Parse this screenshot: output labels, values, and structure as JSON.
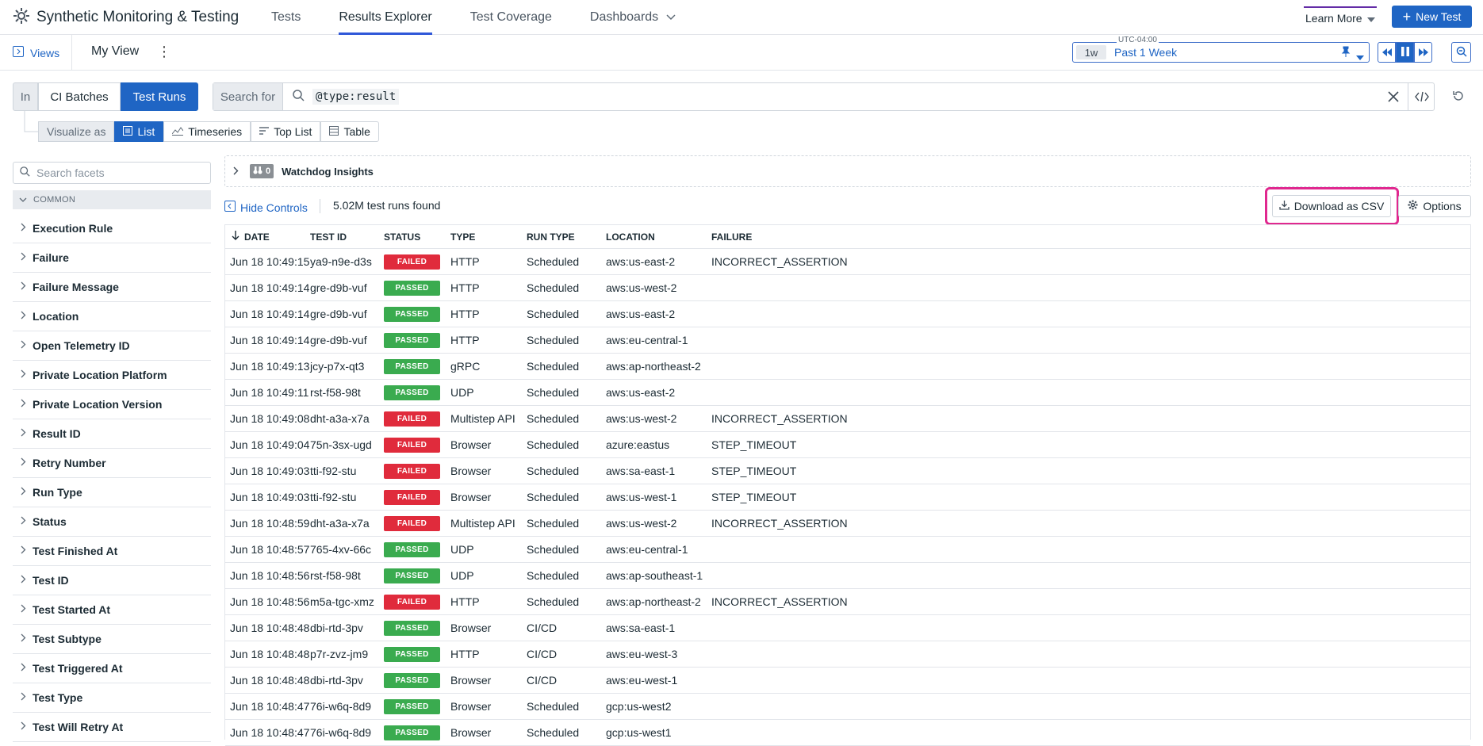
{
  "app": {
    "title": "Synthetic Monitoring & Testing"
  },
  "nav": {
    "tabs": [
      "Tests",
      "Results Explorer",
      "Test Coverage",
      "Dashboards"
    ],
    "active": "Results Explorer"
  },
  "header": {
    "learn_more": "Learn More",
    "new_test": "New Test"
  },
  "viewbar": {
    "views": "Views",
    "view_name": "My View"
  },
  "time": {
    "timezone": "UTC-04:00",
    "badge": "1w",
    "label": "Past 1 Week"
  },
  "scope": {
    "in_label": "In",
    "options": [
      "CI Batches",
      "Test Runs"
    ],
    "selected": "Test Runs"
  },
  "search": {
    "label": "Search for",
    "query": "@type:result"
  },
  "visualize": {
    "label": "Visualize as",
    "options": [
      "List",
      "Timeseries",
      "Top List",
      "Table"
    ],
    "selected": "List"
  },
  "facets": {
    "search_placeholder": "Search facets",
    "group": "COMMON",
    "items": [
      "Execution Rule",
      "Failure",
      "Failure Message",
      "Location",
      "Open Telemetry ID",
      "Private Location Platform",
      "Private Location Version",
      "Result ID",
      "Retry Number",
      "Run Type",
      "Status",
      "Test Finished At",
      "Test ID",
      "Test Started At",
      "Test Subtype",
      "Test Triggered At",
      "Test Type",
      "Test Will Retry At"
    ]
  },
  "watchdog": {
    "count": "0",
    "label": "Watchdog Insights"
  },
  "controls": {
    "hide": "Hide Controls",
    "found": "5.02M test runs found",
    "download": "Download as CSV",
    "options": "Options"
  },
  "table": {
    "columns": [
      "DATE",
      "TEST ID",
      "STATUS",
      "TYPE",
      "RUN TYPE",
      "LOCATION",
      "FAILURE"
    ],
    "rows": [
      [
        "Jun 18 10:49:15",
        "ya9-n9e-d3s",
        "FAILED",
        "HTTP",
        "Scheduled",
        "aws:us-east-2",
        "INCORRECT_ASSERTION"
      ],
      [
        "Jun 18 10:49:14",
        "gre-d9b-vuf",
        "PASSED",
        "HTTP",
        "Scheduled",
        "aws:us-west-2",
        ""
      ],
      [
        "Jun 18 10:49:14",
        "gre-d9b-vuf",
        "PASSED",
        "HTTP",
        "Scheduled",
        "aws:us-east-2",
        ""
      ],
      [
        "Jun 18 10:49:14",
        "gre-d9b-vuf",
        "PASSED",
        "HTTP",
        "Scheduled",
        "aws:eu-central-1",
        ""
      ],
      [
        "Jun 18 10:49:13",
        "jcy-p7x-qt3",
        "PASSED",
        "gRPC",
        "Scheduled",
        "aws:ap-northeast-2",
        ""
      ],
      [
        "Jun 18 10:49:11",
        "rst-f58-98t",
        "PASSED",
        "UDP",
        "Scheduled",
        "aws:us-east-2",
        ""
      ],
      [
        "Jun 18 10:49:08",
        "dht-a3a-x7a",
        "FAILED",
        "Multistep API",
        "Scheduled",
        "aws:us-west-2",
        "INCORRECT_ASSERTION"
      ],
      [
        "Jun 18 10:49:04",
        "75n-3sx-ugd",
        "FAILED",
        "Browser",
        "Scheduled",
        "azure:eastus",
        "STEP_TIMEOUT"
      ],
      [
        "Jun 18 10:49:03",
        "tti-f92-stu",
        "FAILED",
        "Browser",
        "Scheduled",
        "aws:sa-east-1",
        "STEP_TIMEOUT"
      ],
      [
        "Jun 18 10:49:03",
        "tti-f92-stu",
        "FAILED",
        "Browser",
        "Scheduled",
        "aws:us-west-1",
        "STEP_TIMEOUT"
      ],
      [
        "Jun 18 10:48:59",
        "dht-a3a-x7a",
        "FAILED",
        "Multistep API",
        "Scheduled",
        "aws:us-west-2",
        "INCORRECT_ASSERTION"
      ],
      [
        "Jun 18 10:48:57",
        "765-4xv-66c",
        "PASSED",
        "UDP",
        "Scheduled",
        "aws:eu-central-1",
        ""
      ],
      [
        "Jun 18 10:48:56",
        "rst-f58-98t",
        "PASSED",
        "UDP",
        "Scheduled",
        "aws:ap-southeast-1",
        ""
      ],
      [
        "Jun 18 10:48:56",
        "m5a-tgc-xmz",
        "FAILED",
        "HTTP",
        "Scheduled",
        "aws:ap-northeast-2",
        "INCORRECT_ASSERTION"
      ],
      [
        "Jun 18 10:48:48",
        "dbi-rtd-3pv",
        "PASSED",
        "Browser",
        "CI/CD",
        "aws:sa-east-1",
        ""
      ],
      [
        "Jun 18 10:48:48",
        "p7r-zvz-jm9",
        "PASSED",
        "HTTP",
        "CI/CD",
        "aws:eu-west-3",
        ""
      ],
      [
        "Jun 18 10:48:48",
        "dbi-rtd-3pv",
        "PASSED",
        "Browser",
        "CI/CD",
        "aws:eu-west-1",
        ""
      ],
      [
        "Jun 18 10:48:47",
        "76i-w6q-8d9",
        "PASSED",
        "Browser",
        "Scheduled",
        "gcp:us-west2",
        ""
      ],
      [
        "Jun 18 10:48:47",
        "76i-w6q-8d9",
        "PASSED",
        "Browser",
        "Scheduled",
        "gcp:us-west1",
        ""
      ]
    ]
  },
  "colors": {
    "accent": "#1f65c4",
    "failed": "#e02b3c",
    "passed": "#3aab4f",
    "highlight": "#e0288f"
  }
}
